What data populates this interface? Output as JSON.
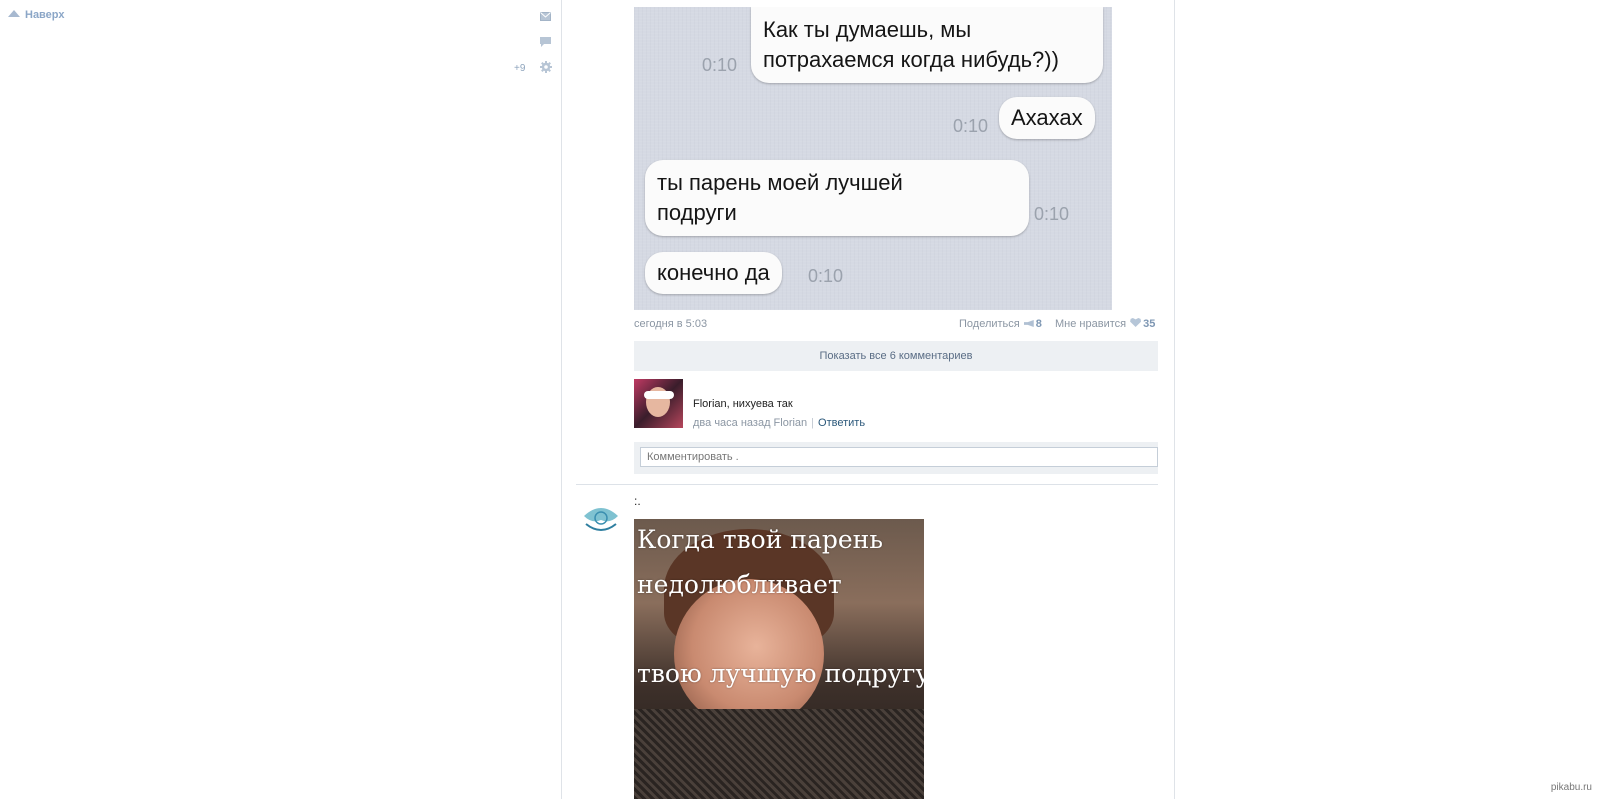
{
  "sidebar": {
    "top_link": "Наверх",
    "counter": "+9",
    "icons": [
      "mail-icon",
      "chat-icon",
      "gear-icon"
    ]
  },
  "post1": {
    "chat": {
      "messages": [
        {
          "text": "Как ты думаешь, мы потрахаемся когда нибудь?))",
          "time": "0:10",
          "side": "right"
        },
        {
          "text": "Ахахах",
          "time": "0:10",
          "side": "right"
        },
        {
          "text": "ты парень моей лучшей подруги",
          "time": "0:10",
          "side": "left"
        },
        {
          "text": "конечно да",
          "time": "0:10",
          "side": "left"
        }
      ]
    },
    "time": "сегодня в 5:03",
    "share_label": "Поделиться",
    "share_count": "8",
    "like_label": "Мне нравится",
    "like_count": "35",
    "show_all_comments": "Показать все 6 комментариев",
    "comment": {
      "text": "Florian, нихуева так",
      "meta": "два часа назад Florian",
      "reply": "Ответить"
    },
    "comment_placeholder": "Комментировать ."
  },
  "post2": {
    "text": ":.",
    "meme_lines": [
      "Когда твой парень",
      "недолюбливает",
      "твою лучшую подругу."
    ]
  },
  "watermark": "pikabu.ru"
}
